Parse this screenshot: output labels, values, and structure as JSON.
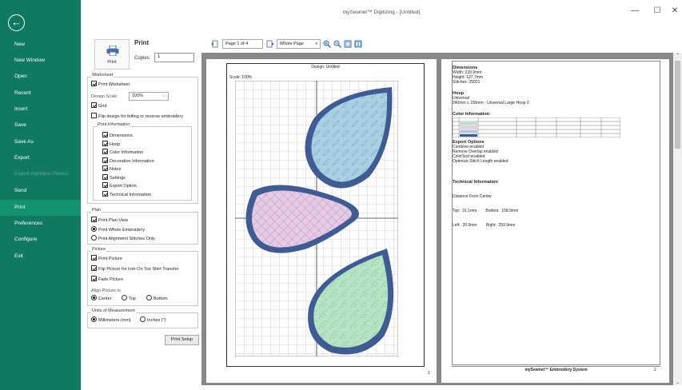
{
  "app": {
    "title": "mySewnet™ Digitizing - [Untitled]",
    "back_icon": "←"
  },
  "sidebar": {
    "items": [
      {
        "label": "New",
        "state": "normal"
      },
      {
        "label": "New Window",
        "state": "normal"
      },
      {
        "label": "Open",
        "state": "normal"
      },
      {
        "label": "Recent",
        "state": "normal"
      },
      {
        "label": "Insert",
        "state": "normal"
      },
      {
        "label": "Save",
        "state": "normal"
      },
      {
        "label": "Save As",
        "state": "normal"
      },
      {
        "label": "Export",
        "state": "normal"
      },
      {
        "label": "Export Appliqué Pieces",
        "state": "disabled"
      },
      {
        "label": "Send",
        "state": "normal"
      },
      {
        "label": "Print",
        "state": "active"
      },
      {
        "label": "Preferences",
        "state": "normal"
      },
      {
        "label": "Configure",
        "state": "normal"
      },
      {
        "label": "Exit",
        "state": "normal"
      }
    ]
  },
  "window_controls": {
    "minimize": "—",
    "maximize": "☐",
    "close": "✕"
  },
  "print_panel": {
    "print_button_label": "Print",
    "heading": "Print",
    "copies_label": "Copies:",
    "copies_value": "1",
    "worksheet": {
      "legend": "Worksheet",
      "print_worksheet": "Print Worksheet",
      "design_scale_label": "Design Scale",
      "design_scale_value": "100%",
      "grid": "Grid",
      "flip_design": "Flip design for felting or reverse embroidery",
      "print_information": {
        "legend": "Print Information",
        "items": [
          "Dimensions",
          "Hoop",
          "Color Information",
          "Decoration Information",
          "Notes",
          "Settings",
          "Export Option",
          "Technical Information"
        ]
      }
    },
    "plan": {
      "legend": "Plan",
      "print_plan_view": "Print Plan View",
      "print_whole_embroidery": "Print Whole Embroidery",
      "print_alignment_stitches": "Print Alignment Stitches Only"
    },
    "picture": {
      "legend": "Picture",
      "print_picture": "Print Picture",
      "flip_picture": "Flip Picture for Iron-On Tee Shirt Transfer",
      "fade_picture": "Fade Picture",
      "align_label": "Align Picture to",
      "align_center": "Center",
      "align_top": "Top",
      "align_bottom": "Bottom"
    },
    "units": {
      "legend": "Units of Measurement",
      "millimeters": "Millimeters (mm)",
      "inches": "Inches (\")"
    },
    "print_setup": "Print Setup"
  },
  "preview_toolbar": {
    "page_value": "Page 1 of 4",
    "zoom_value": "Whole Page"
  },
  "page1": {
    "design_label": "Design: Untitled",
    "scale_label": "Scale: 100%",
    "page_number": "1"
  },
  "page2": {
    "dimensions": {
      "head": "Dimensions",
      "lines": [
        "Width:  239.9mm",
        "Height:  127.7mm",
        "Stitches:  25021"
      ]
    },
    "hoop": {
      "head": "Hoop",
      "lines": [
        "Universal",
        "240mm x 150mm - Universal Large Hoop 2"
      ]
    },
    "color": {
      "head": "Color Information"
    },
    "export": {
      "head": "Export Options",
      "lines": [
        "Combine enabled",
        "Remove Overlap enabled",
        "ColorSort enabled",
        "Optimize Stitch Length enabled"
      ]
    },
    "technical": {
      "head": "Technical Information",
      "lines": [
        "Distance From Center",
        "Top:  31.1mm        Bottom:  158.9mm",
        "Left:  20.0mm        Right:  259.9mm"
      ]
    },
    "footer": "mySewnet™ Embroidery System",
    "page_number": "2"
  },
  "colors": {
    "sidebar_bg": "#0f7a61",
    "sidebar_active": "#12926f",
    "outline_blue": "#3e5c93",
    "fill_blue": "#a9cfe2",
    "fill_pink": "#e6cbe4",
    "fill_green": "#b6e3c3"
  }
}
